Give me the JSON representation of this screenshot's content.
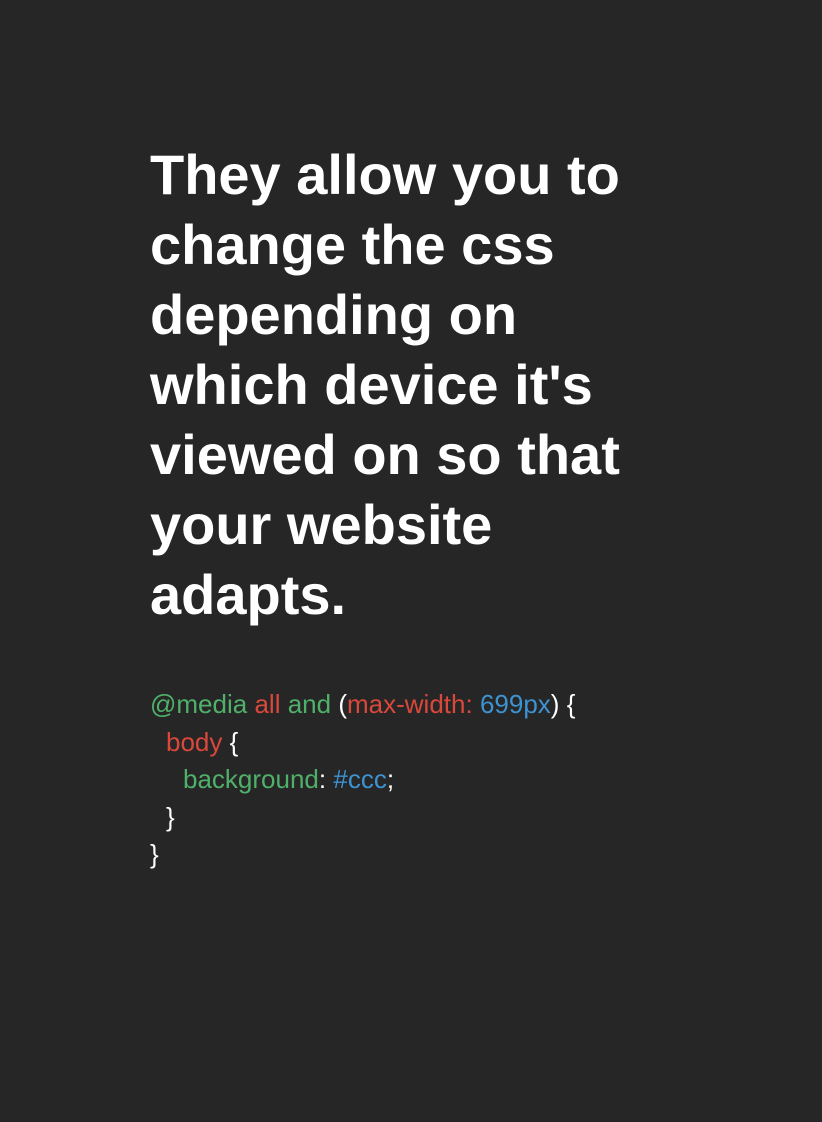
{
  "colors": {
    "background": "#262626",
    "text": "#ffffff",
    "green": "#4fb06a",
    "red": "#d9483b",
    "blue": "#3d93d1",
    "white": "#ffffff"
  },
  "headline": {
    "lines": [
      "They allow you to",
      "change the css",
      "depending on",
      "which device it's",
      "viewed on so that",
      "your website",
      "adapts."
    ]
  },
  "code": {
    "line1": {
      "at_media": "@media",
      "space1": " ",
      "all": "all",
      "space2": " ",
      "and": "and",
      "space3": " ",
      "open_paren": "(",
      "property": "max-width:",
      "space4": " ",
      "value": "699px",
      "close_paren": ")",
      "space5": " ",
      "open_brace": "{"
    },
    "line2": {
      "selector": "body",
      "space": " ",
      "open_brace": "{"
    },
    "line3": {
      "property": "background",
      "colon": ":",
      "space": " ",
      "value": "#ccc",
      "semicolon": ";"
    },
    "line4": {
      "close_brace": "}"
    },
    "line5": {
      "close_brace": "}"
    }
  }
}
